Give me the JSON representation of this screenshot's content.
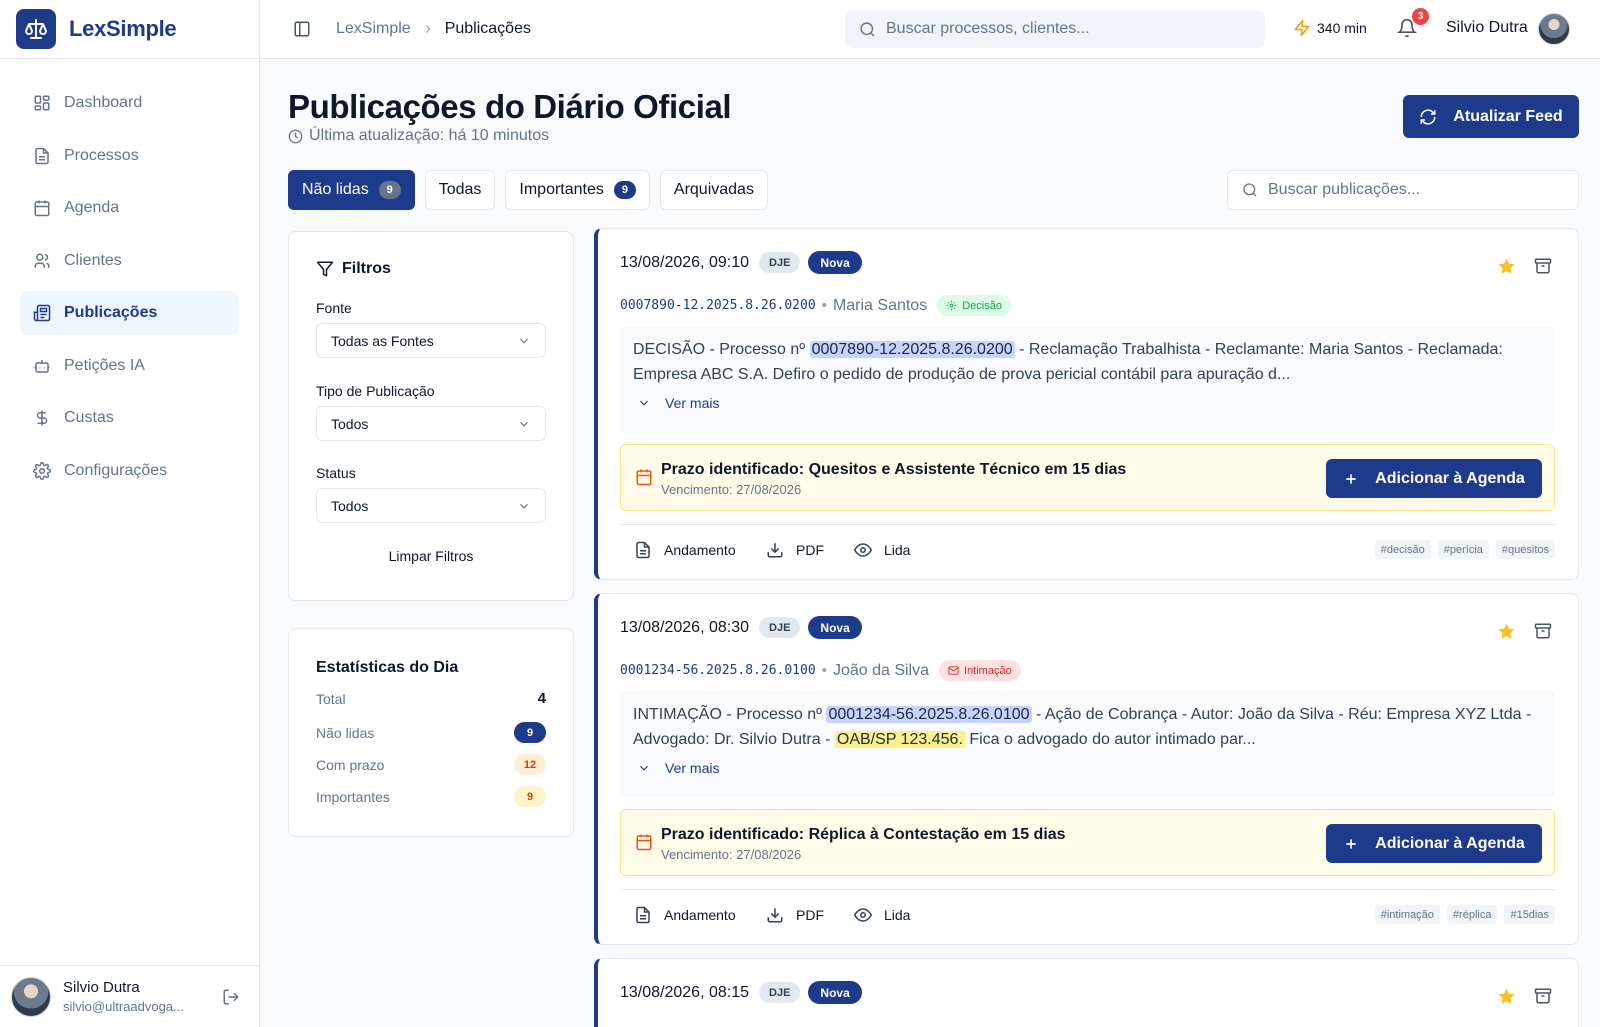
{
  "brand": {
    "name": "LexSimple"
  },
  "sidebar": {
    "items": [
      {
        "label": "Dashboard",
        "icon": "dashboard-icon"
      },
      {
        "label": "Processos",
        "icon": "file-icon"
      },
      {
        "label": "Agenda",
        "icon": "calendar-icon"
      },
      {
        "label": "Clientes",
        "icon": "users-icon"
      },
      {
        "label": "Publicações",
        "icon": "newspaper-icon",
        "active": true
      },
      {
        "label": "Petições IA",
        "icon": "bot-icon"
      },
      {
        "label": "Custas",
        "icon": "dollar-icon"
      },
      {
        "label": "Configurações",
        "icon": "gear-icon"
      }
    ],
    "user": {
      "name": "Silvio Dutra",
      "email": "silvio@ultraadvoga..."
    }
  },
  "topbar": {
    "breadcrumb": [
      "LexSimple",
      "Publicações"
    ],
    "search_placeholder": "Buscar processos, clientes...",
    "credits": "340 min",
    "notifications": "3",
    "user_name": "Silvio Dutra"
  },
  "page": {
    "title": "Publicações do Diário Oficial",
    "subtitle": "Última atualização: há 10 minutos",
    "refresh_label": "Atualizar Feed",
    "search_placeholder": "Buscar publicações...",
    "tabs": [
      {
        "label": "Não lidas",
        "count": "9"
      },
      {
        "label": "Todas"
      },
      {
        "label": "Importantes",
        "count": "9"
      },
      {
        "label": "Arquivadas"
      }
    ]
  },
  "filters": {
    "title": "Filtros",
    "source_label": "Fonte",
    "source_value": "Todas as Fontes",
    "type_label": "Tipo de Publicação",
    "type_value": "Todos",
    "status_label": "Status",
    "status_value": "Todos",
    "clear_label": "Limpar Filtros"
  },
  "stats": {
    "title": "Estatísticas do Dia",
    "rows": [
      {
        "label": "Total",
        "value": "4"
      },
      {
        "label": "Não lidas",
        "value": "9"
      },
      {
        "label": "Com prazo",
        "value": "12"
      },
      {
        "label": "Importantes",
        "value": "9"
      }
    ]
  },
  "publications": [
    {
      "date": "13/08/2026, 09:10",
      "source": "DJE",
      "status": "Nova",
      "process": "0007890-12.2025.8.26.0200",
      "party": "Maria Santos",
      "type": "Decisão",
      "text_pre": "DECISÃO - Processo nº ",
      "text_hl": "0007890-12.2025.8.26.0200",
      "text_post": " - Reclamação Trabalhista - Reclamante: Maria Santos - Reclamada: Empresa ABC S.A. Defiro o pedido de produção de prova pericial contábil para apuração d...",
      "more": "Ver mais",
      "deadline_title": "Prazo identificado: Quesitos e Assistente Técnico em 15 dias",
      "deadline_date": "Vencimento: 27/08/2026",
      "agenda_label": "Adicionar à Agenda",
      "actions": [
        "Andamento",
        "PDF",
        "Lida"
      ],
      "tags": [
        "#decisão",
        "#perícia",
        "#quesitos"
      ]
    },
    {
      "date": "13/08/2026, 08:30",
      "source": "DJE",
      "status": "Nova",
      "process": "0001234-56.2025.8.26.0100",
      "party": "João da Silva",
      "type": "Intimação",
      "text_pre": "INTIMAÇÃO - Processo nº ",
      "text_hl": "0001234-56.2025.8.26.0100",
      "text_mid": " - Ação de Cobrança - Autor: João da Silva - Réu: Empresa XYZ Ltda - Advogado: Dr. Silvio Dutra - ",
      "text_hl2": "OAB/SP 123.456.",
      "text_post": " Fica o advogado do autor intimado par...",
      "more": "Ver mais",
      "deadline_title": "Prazo identificado: Réplica à Contestação em 15 dias",
      "deadline_date": "Vencimento: 27/08/2026",
      "agenda_label": "Adicionar à Agenda",
      "actions": [
        "Andamento",
        "PDF",
        "Lida"
      ],
      "tags": [
        "#intimação",
        "#réplica",
        "#15dias"
      ]
    },
    {
      "date": "13/08/2026, 08:15",
      "source": "DJE",
      "status": "Nova"
    }
  ]
}
